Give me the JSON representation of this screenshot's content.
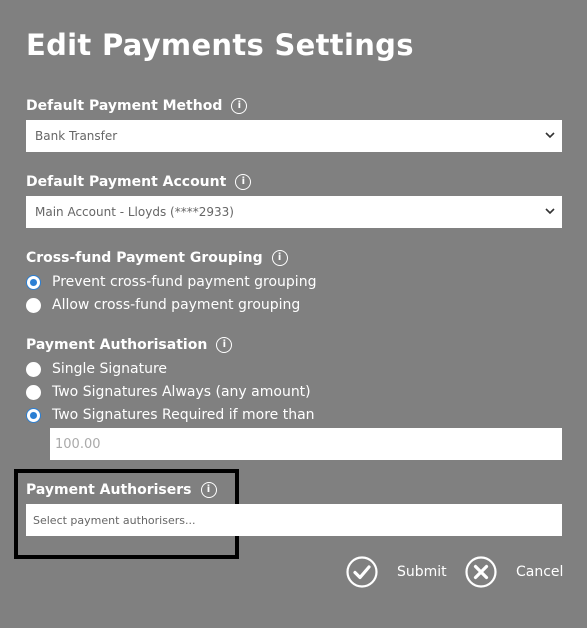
{
  "title": "Edit Payments Settings",
  "info_glyph": "i",
  "default_method": {
    "label": "Default Payment Method",
    "value": "Bank Transfer"
  },
  "default_account": {
    "label": "Default Payment Account",
    "value": "Main Account - Lloyds (****2933)"
  },
  "grouping": {
    "label": "Cross-fund Payment Grouping",
    "options": [
      {
        "label": "Prevent cross-fund payment grouping",
        "selected": true
      },
      {
        "label": "Allow cross-fund payment grouping",
        "selected": false
      }
    ]
  },
  "authorisation": {
    "label": "Payment Authorisation",
    "options": [
      {
        "label": "Single Signature",
        "selected": false
      },
      {
        "label": "Two Signatures Always (any amount)",
        "selected": false
      },
      {
        "label": "Two Signatures Required if more than",
        "selected": true
      }
    ],
    "threshold_placeholder": "100.00"
  },
  "authorisers": {
    "label": "Payment Authorisers",
    "placeholder": "Select payment authorisers..."
  },
  "actions": {
    "submit": "Submit",
    "cancel": "Cancel"
  },
  "colors": {
    "background": "#808080",
    "radio_selected": "#2a7fd4",
    "highlight_border": "#000000"
  },
  "icons": {
    "info": "info-circle-icon",
    "dropdown": "chevron-down-icon",
    "submit": "check-circle-icon",
    "cancel": "x-circle-icon"
  }
}
